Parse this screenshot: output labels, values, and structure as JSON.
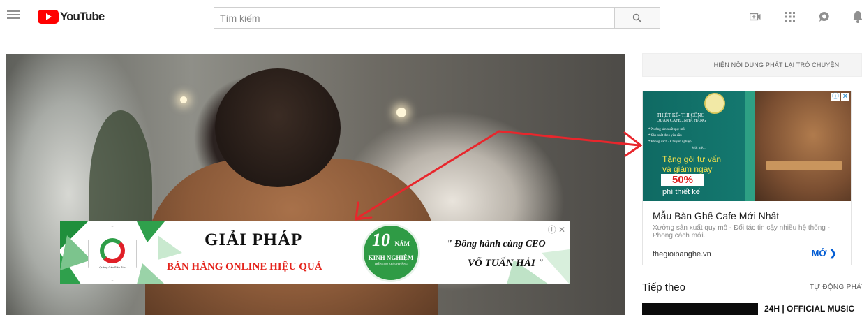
{
  "header": {
    "logo_text": "YouTube",
    "search": {
      "placeholder": "Tìm kiếm",
      "value": ""
    },
    "icons": [
      "menu-icon",
      "search-icon",
      "video-camera-icon",
      "apps-grid-icon",
      "messages-icon",
      "bell-icon"
    ]
  },
  "player": {
    "overlay_ad": {
      "logo_caption": "Quảng Cáo Siêu Tốc",
      "title": "GIẢI PHÁP",
      "subtitle": "BÁN HÀNG ONLINE HIỆU QUẢ",
      "badge_number": "10",
      "badge_unit": "NĂM",
      "badge_text": "KINH NGHIỆM",
      "badge_small": "TRÊN 1000 KHÁCH HÀNG",
      "quote_line1": "\" Đồng hành cùng CEO",
      "quote_line2": "VÕ TUẤN HẢI \"",
      "close_label": "ⓘ ✕"
    }
  },
  "sidebar": {
    "chat_replay_label": "HIỆN NỘI DUNG PHÁT LẠI TRÒ CHUYỆN",
    "ad": {
      "image_text": {
        "heading1": "THIẾT KẾ- THI CÔNG",
        "heading2": "QUÁN CAFE...NHÀ HÀNG",
        "bullet1": "* Xưởng sản xuất quy mô",
        "bullet2": "* Sản xuất theo yêu cầu",
        "bullet3": "* Phong cách - Chuyên nghiệp",
        "bullet4": "Mới mẻ...",
        "promo1": "Tặng gói tư vấn",
        "promo2": "và giảm ngay",
        "discount": "50%",
        "promo3": "phí thiết kế"
      },
      "title": "Mẫu Bàn Ghế Cafe Mới Nhất",
      "description": "Xưởng sản xuất quy mô - Đối tác tin cậy nhiều hệ thống - Phong cách mới.",
      "domain": "thegioibanghe.vn",
      "cta": "MỞ ❯"
    },
    "up_next_label": "Tiếp theo",
    "autoplay_label": "TỰ ĐỘNG PHÁT",
    "next_video_title": "24H | OFFICIAL MUSIC"
  },
  "colors": {
    "brand_red": "#ff0000",
    "annotation_red": "#e8262c",
    "ad_green": "#2f9b45",
    "link_blue": "#065fd4"
  }
}
